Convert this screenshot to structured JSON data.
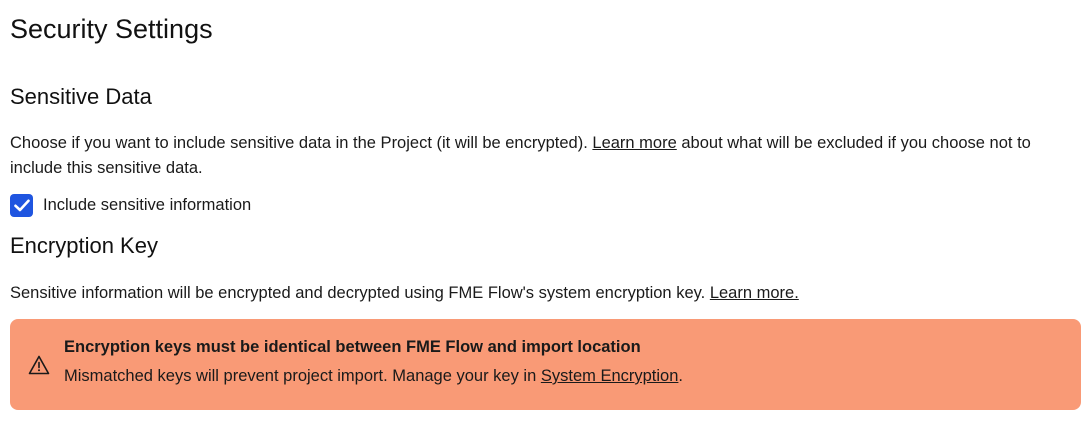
{
  "page": {
    "title": "Security Settings"
  },
  "sensitive_data": {
    "heading": "Sensitive Data",
    "description_before": "Choose if you want to include sensitive data in the Project (it will be encrypted). ",
    "learn_more_link": "Learn more",
    "description_after": " about what will be excluded if you choose not to include this sensitive data.",
    "checkbox": {
      "label": "Include sensitive information",
      "checked": true,
      "color": "#1f55e0"
    }
  },
  "encryption_key": {
    "heading": "Encryption Key",
    "description": "Sensitive information will be encrypted and decrypted using FME Flow's system encryption key. ",
    "learn_more_link": "Learn more.",
    "alert": {
      "icon": "warning-triangle-icon",
      "title": "Encryption keys must be identical between FME Flow and import location",
      "body_before": "Mismatched keys will prevent project import. Manage your key in ",
      "body_link": "System Encryption",
      "body_after": ".",
      "background": "#f99a76"
    }
  }
}
